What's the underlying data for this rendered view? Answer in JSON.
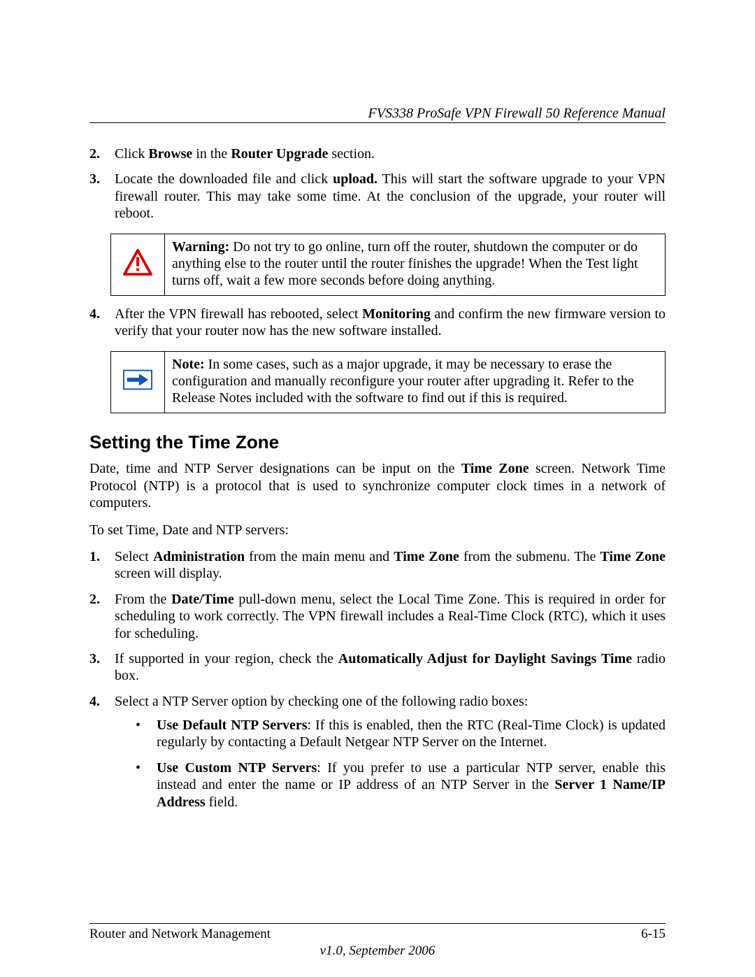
{
  "header": {
    "title": "FVS338 ProSafe VPN Firewall 50 Reference Manual"
  },
  "step2": {
    "num": "2.",
    "t1": "Click ",
    "b1": "Browse",
    "t2": " in the ",
    "b2": "Router Upgrade",
    "t3": " section."
  },
  "step3": {
    "num": "3.",
    "t1": "Locate the downloaded file and click ",
    "b1": "upload.",
    "t2": " This will start the software upgrade to your VPN firewall router. This may take some time. At the conclusion of the upgrade, your router will reboot."
  },
  "warning": {
    "label": "Warning:",
    "text": " Do not try to go online, turn off the router, shutdown the computer or do anything else to the router until the router finishes the upgrade! When the Test light turns off, wait a few more seconds before doing anything."
  },
  "step4": {
    "num": "4.",
    "t1": "After the VPN firewall has rebooted, select ",
    "b1": "Monitoring",
    "t2": " and confirm the new firmware version to verify that your router now has the new software installed."
  },
  "note": {
    "label": "Note:",
    "text": " In some cases, such as a major upgrade, it may be necessary to erase the configuration and manually reconfigure your router after upgrading it. Refer to the Release Notes included with the software to find out if this is required."
  },
  "section_heading": "Setting the Time Zone",
  "intro": {
    "t1": "Date, time and NTP Server designations can be input on the ",
    "b1": "Time Zone",
    "t2": " screen. Network Time Protocol (NTP) is a protocol that is used to synchronize computer clock times in a network of computers."
  },
  "leadin": "To set Time, Date and NTP servers:",
  "tz1": {
    "num": "1.",
    "t1": "Select ",
    "b1": "Administration",
    "t2": " from the main menu and ",
    "b2": "Time Zone",
    "t3": " from the submenu. The ",
    "b3": "Time Zone",
    "t4": " screen will display."
  },
  "tz2": {
    "num": "2.",
    "t1": "From the ",
    "b1": "Date/Time",
    "t2": " pull-down menu, select the Local Time Zone. This is required in order for scheduling to work correctly. The VPN firewall includes a Real-Time Clock (RTC), which it uses for scheduling."
  },
  "tz3": {
    "num": "3.",
    "t1": "If supported in your region, check the ",
    "b1": "Automatically Adjust for Daylight Savings Time",
    "t2": " radio box."
  },
  "tz4": {
    "num": "4.",
    "text": "Select a NTP Server option by checking one of the following radio boxes:"
  },
  "bul1": {
    "b1": "Use Default NTP Servers",
    "t1": ": If this is enabled, then the RTC (Real-Time Clock) is updated regularly by contacting a Default Netgear NTP Server on the Internet."
  },
  "bul2": {
    "b1": "Use Custom NTP Servers",
    "t1": ": If you prefer to use a particular NTP server, enable this instead and enter the name or IP address of an NTP Server in the ",
    "b2": "Server 1 Name/IP Address",
    "t2": " field."
  },
  "footer": {
    "left": "Router and Network Management",
    "right": "6-15",
    "center": "v1.0, September 2006"
  }
}
